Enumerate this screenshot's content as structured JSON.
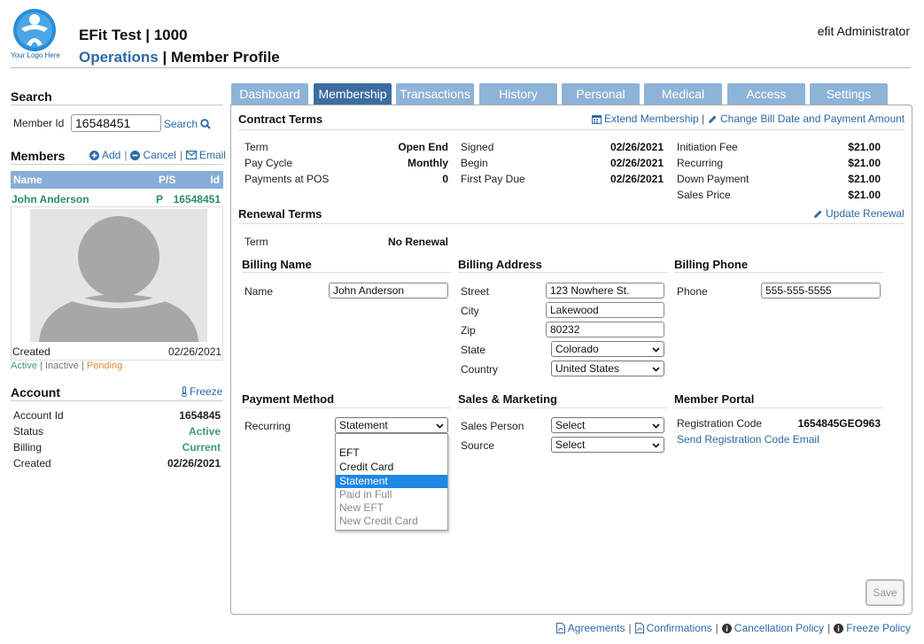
{
  "header": {
    "logo_text": "Your Logo Here",
    "app_title": "EFit Test | 1000",
    "section": "Operations",
    "separator": " | ",
    "page": "Member Profile",
    "user": "efit Administrator"
  },
  "search": {
    "title": "Search",
    "member_id_label": "Member Id",
    "member_id_value": "16548451",
    "search_label": "Search"
  },
  "members": {
    "title": "Members",
    "add_label": "Add",
    "cancel_label": "Cancel",
    "email_label": "Email",
    "columns": [
      "Name",
      "P/S",
      "Id"
    ],
    "row": {
      "name": "John Anderson",
      "ps": "P",
      "id": "16548451"
    },
    "created_label": "Created",
    "created_value": "02/26/2021",
    "status_active": "Active",
    "status_inactive": "Inactive",
    "status_pending": "Pending"
  },
  "account": {
    "title": "Account",
    "freeze_label": "Freeze",
    "rows": [
      {
        "label": "Account Id",
        "value": "1654845"
      },
      {
        "label": "Status",
        "value": "Active"
      },
      {
        "label": "Billing",
        "value": "Current"
      },
      {
        "label": "Created",
        "value": "02/26/2021"
      }
    ]
  },
  "tabs": [
    "Dashboard",
    "Membership",
    "Transactions",
    "History",
    "Personal",
    "Medical",
    "Access",
    "Settings"
  ],
  "active_tab": "Membership",
  "contract": {
    "title": "Contract Terms",
    "extend_label": "Extend Membership",
    "change_label": "Change Bill Date and Payment Amount",
    "col1": [
      {
        "label": "Term",
        "value": "Open End"
      },
      {
        "label": "Pay Cycle",
        "value": "Monthly"
      },
      {
        "label": "Payments at POS",
        "value": "0"
      }
    ],
    "col2": [
      {
        "label": "Signed",
        "value": "02/26/2021"
      },
      {
        "label": "Begin",
        "value": "02/26/2021"
      },
      {
        "label": "First Pay Due",
        "value": "02/26/2021"
      }
    ],
    "col3": [
      {
        "label": "Initiation Fee",
        "value": "$21.00"
      },
      {
        "label": "Recurring",
        "value": "$21.00"
      },
      {
        "label": "Down Payment",
        "value": "$21.00"
      },
      {
        "label": "Sales Price",
        "value": "$21.00"
      }
    ]
  },
  "renewal": {
    "title": "Renewal Terms",
    "update_label": "Update Renewal",
    "term_label": "Term",
    "term_value": "No Renewal"
  },
  "billing_name": {
    "title": "Billing Name",
    "name_label": "Name",
    "name_value": "John Anderson"
  },
  "billing_address": {
    "title": "Billing Address",
    "street_label": "Street",
    "street_value": "123 Nowhere St.",
    "city_label": "City",
    "city_value": "Lakewood",
    "zip_label": "Zip",
    "zip_value": "80232",
    "state_label": "State",
    "state_value": "Colorado",
    "country_label": "Country",
    "country_value": "United States"
  },
  "billing_phone": {
    "title": "Billing Phone",
    "phone_label": "Phone",
    "phone_value": "555-555-5555"
  },
  "payment": {
    "title": "Payment Method",
    "recurring_label": "Recurring",
    "recurring_value": "Statement",
    "options": [
      "",
      "EFT",
      "Credit Card",
      "Statement",
      "Paid in Full",
      "New EFT",
      "New Credit Card"
    ]
  },
  "sales": {
    "title": "Sales & Marketing",
    "person_label": "Sales Person",
    "person_value": "Select",
    "source_label": "Source",
    "source_value": "Select"
  },
  "portal": {
    "title": "Member Portal",
    "code_label": "Registration Code",
    "code_value": "1654845GEO963",
    "send_label": "Send Registration Code Email"
  },
  "save_label": "Save",
  "footer": {
    "agreements": "Agreements",
    "confirmations": "Confirmations",
    "cancellation": "Cancellation Policy",
    "freeze": "Freeze Policy"
  },
  "colors": {
    "tab": "#8db3d7",
    "tab_active": "#3d6da0",
    "link": "#2b6aa6",
    "green": "#3c9a79",
    "pending": "#e08a2e"
  }
}
